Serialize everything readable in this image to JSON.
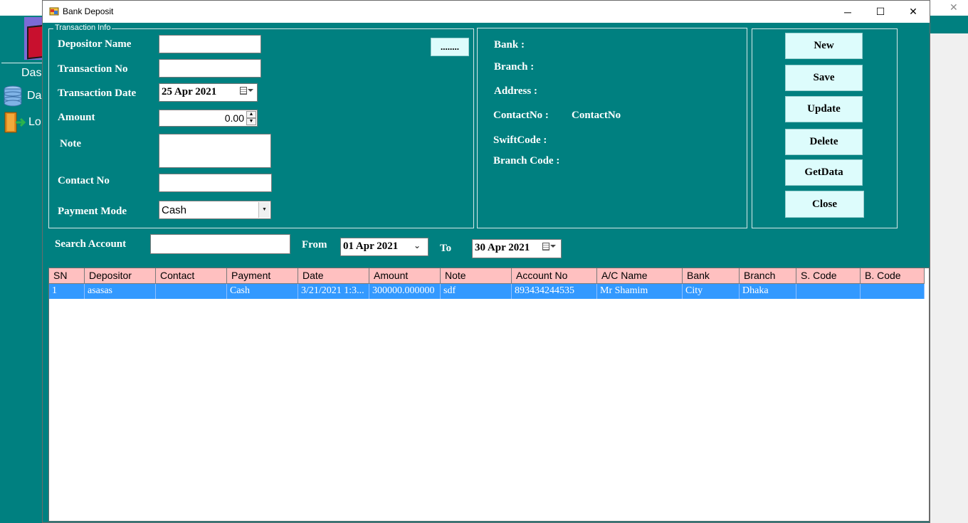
{
  "background_app": {
    "nav_dash": "Das",
    "nav_data": "Da",
    "nav_logout": "Lo"
  },
  "window": {
    "title": "Bank Deposit",
    "min_label": "─",
    "max_label": "☐",
    "close_label": "✕"
  },
  "transaction_info": {
    "group_title": "Transaction Info",
    "depositor_name_label": "Depositor Name",
    "depositor_name_value": "",
    "transaction_no_label": "Transaction No",
    "transaction_no_value": "",
    "transaction_date_label": "Transaction Date",
    "transaction_date_value": "25  Apr  2021",
    "amount_label": "Amount",
    "amount_value": "0.00",
    "note_label": "Note",
    "note_value": "",
    "contact_no_label": "Contact No",
    "contact_no_value": "",
    "payment_mode_label": "Payment Mode",
    "payment_mode_value": "Cash",
    "lookup_button_label": "........"
  },
  "bank_info": {
    "bank_label": "Bank :",
    "branch_label": "Branch :",
    "address_label": "Address :",
    "contactno_label": "ContactNo :",
    "contactno_value": "ContactNo",
    "swiftcode_label": "SwiftCode :",
    "branch_code_label": "Branch Code :"
  },
  "actions": {
    "new": "New",
    "save": "Save",
    "update": "Update",
    "delete": "Delete",
    "getdata": "GetData",
    "close": "Close"
  },
  "search": {
    "search_account_label": "Search Account",
    "search_account_value": "",
    "from_label": "From",
    "from_date": "01  Apr  2021",
    "to_label": "To",
    "to_date": "30  Apr  2021"
  },
  "grid": {
    "columns": [
      "SN",
      "Depositor",
      "Contact",
      "Payment",
      "Date",
      "Amount",
      "Note",
      "Account No",
      "A/C Name",
      "Bank",
      "Branch",
      "S. Code",
      "B. Code"
    ],
    "rows": [
      [
        "1",
        "asasas",
        "",
        "Cash",
        "3/21/2021 1:3...",
        "300000.000000",
        "sdf",
        "893434244535",
        "Mr Shamim",
        "City",
        "Dhaka",
        "",
        ""
      ]
    ]
  },
  "colors": {
    "teal": "#008080",
    "header_pink": "#ffc0c0",
    "selection_blue": "#3399ff",
    "button_cyan": "#ddfcfc"
  }
}
